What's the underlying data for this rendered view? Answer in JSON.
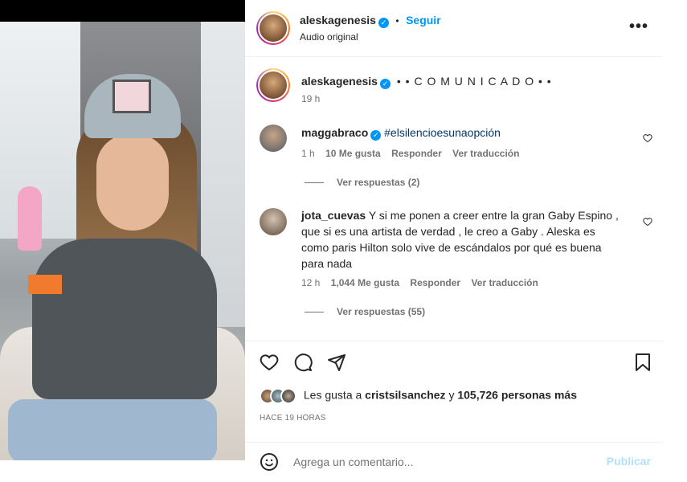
{
  "post_header": {
    "username": "aleskagenesis",
    "separator": "•",
    "follow_label": "Seguir",
    "audio_label": "Audio original",
    "more_label": "•••"
  },
  "caption": {
    "username": "aleskagenesis",
    "text": "• • C O M U N I C A D O • •",
    "time": "19 h"
  },
  "comments": [
    {
      "username": "maggabraco",
      "verified": true,
      "text": "#elsilencioesunaopción",
      "time": "1 h",
      "likes": "10 Me gusta",
      "reply_label": "Responder",
      "translate_label": "Ver traducción",
      "replies_label": "Ver respuestas (2)"
    },
    {
      "username": "jota_cuevas",
      "verified": false,
      "text": "Y si me ponen a creer entre la gran Gaby Espino , que si es una artista de verdad , le creo a Gaby . Aleska es como paris Hilton solo vive de escándalos por qué es buena para nada",
      "time": "12 h",
      "likes": "1,044 Me gusta",
      "reply_label": "Responder",
      "translate_label": "Ver traducción",
      "replies_label": "Ver respuestas (55)"
    }
  ],
  "likes_summary": {
    "prefix": "Les gusta a",
    "user": "cristsilsanchez",
    "connector": "y",
    "count": "105,726 personas más"
  },
  "post_date": "HACE 19 HORAS",
  "composer": {
    "placeholder": "Agrega un comentario...",
    "publish_label": "Publicar"
  },
  "colors": {
    "accent": "#0095f6",
    "text": "#262626",
    "muted": "#737373",
    "publish_disabled": "#b2dffc"
  }
}
